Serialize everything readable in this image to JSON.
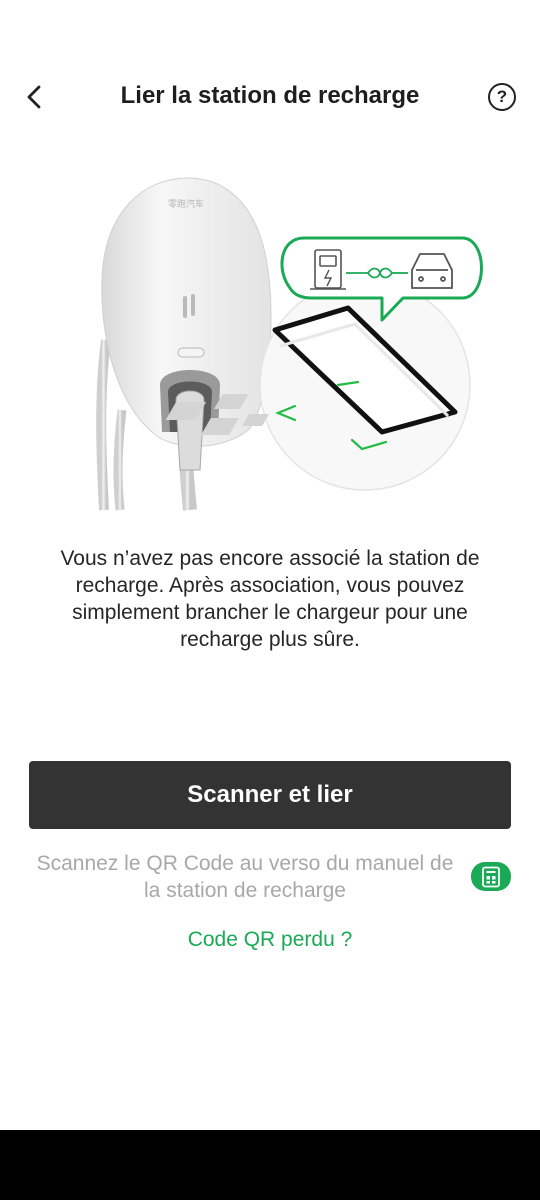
{
  "header": {
    "title": "Lier la station de recharge",
    "help_symbol": "?"
  },
  "illustration": {
    "brand_text": "零跑汽车"
  },
  "main": {
    "description": "Vous n’avez pas encore associé la station de recharge. Après association, vous pouvez simplement brancher le chargeur pour une recharge plus sûre.",
    "scan_button_label": "Scanner et lier",
    "hint": "Scannez le QR Code au verso du manuel de la station de recharge",
    "lost_qr_link": "Code QR perdu ?"
  },
  "colors": {
    "accent_green": "#1aaa55",
    "button_dark": "#333333"
  },
  "icons": {
    "back": "chevron-left-icon",
    "help": "question-circle-icon",
    "manual": "manual-qr-icon"
  }
}
